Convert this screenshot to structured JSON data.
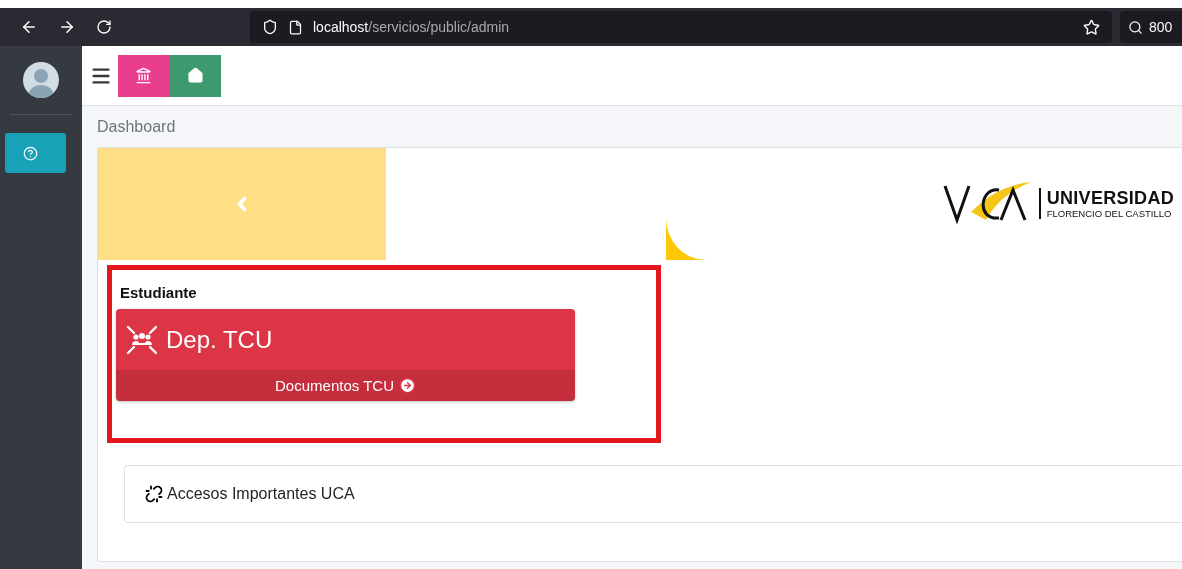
{
  "browser": {
    "url_host": "localhost",
    "url_path": "/servicios/public/admin",
    "search_text": "800"
  },
  "breadcrumb": "Dashboard",
  "logo": {
    "title": "UNIVERSIDAD",
    "subtitle": "FLORENCIO DEL CASTILLO"
  },
  "section": {
    "title": "Estudiante",
    "highlighted": true
  },
  "cards": [
    {
      "title": "Dep. TCU",
      "link": "Documentos TCU",
      "color": "#dc3545"
    }
  ],
  "links_panel": {
    "title": "Accesos Importantes UCA"
  }
}
